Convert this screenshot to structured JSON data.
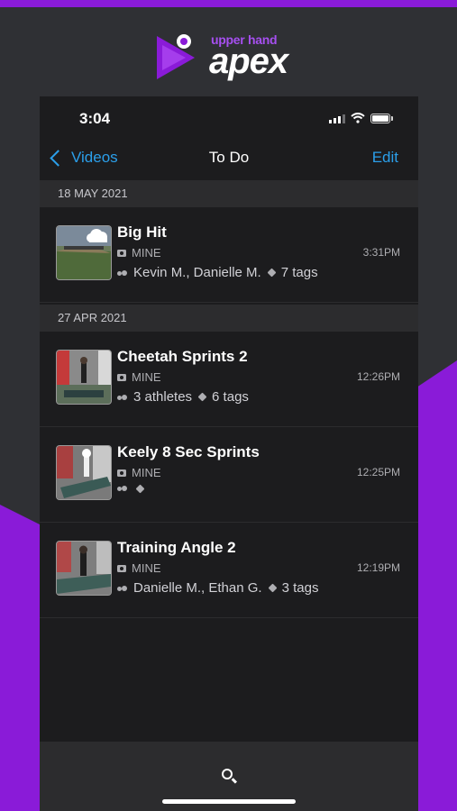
{
  "brand": {
    "tagline": "upper hand",
    "name": "apex"
  },
  "status_bar": {
    "time": "3:04"
  },
  "nav": {
    "back_label": "Videos",
    "title": "To Do",
    "edit_label": "Edit"
  },
  "sections": [
    {
      "date": "18 MAY 2021",
      "items": [
        {
          "title": "Big Hit",
          "owner": "MINE",
          "time": "3:31PM",
          "athletes": "Kevin M., Danielle M.",
          "tags": "7 tags"
        }
      ]
    },
    {
      "date": "27 APR 2021",
      "items": [
        {
          "title": "Cheetah Sprints 2",
          "owner": "MINE",
          "time": "12:26PM",
          "athletes": "3 athletes",
          "tags": "6 tags"
        },
        {
          "title": "Keely 8 Sec Sprints",
          "owner": "MINE",
          "time": "12:25PM",
          "athletes": "",
          "tags": ""
        },
        {
          "title": "Training Angle 2",
          "owner": "MINE",
          "time": "12:19PM",
          "athletes": "Danielle M., Ethan G.",
          "tags": "3 tags"
        }
      ]
    }
  ],
  "colors": {
    "accent": "#2b9fea",
    "brand_purple": "#8a1bd8",
    "background": "#1c1c1e"
  },
  "icons": {
    "tab_search": "search-icon"
  }
}
